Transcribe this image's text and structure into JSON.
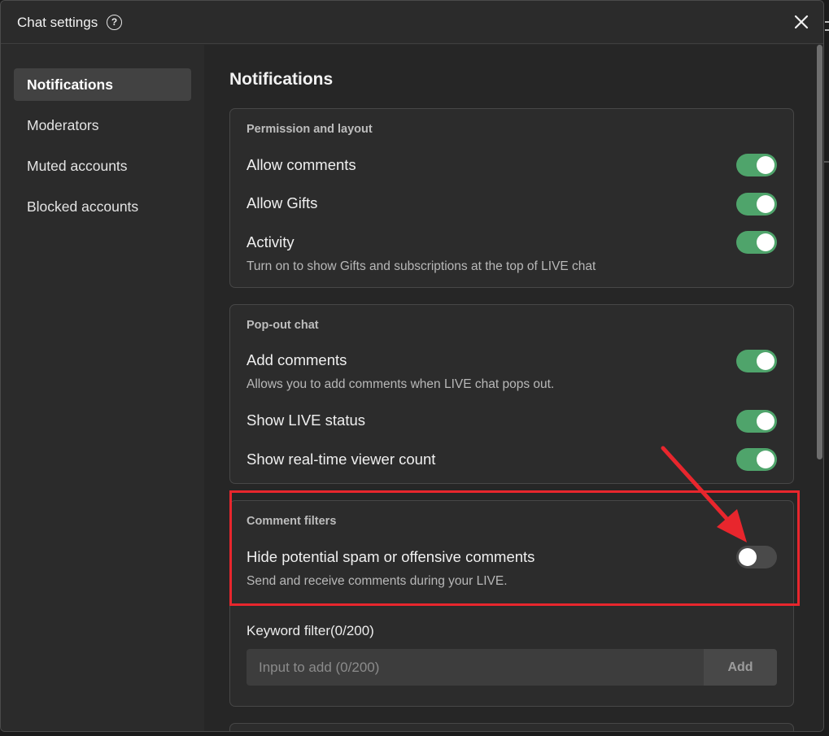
{
  "window": {
    "title": "Chat settings"
  },
  "sidebar": {
    "items": [
      {
        "label": "Notifications",
        "active": true
      },
      {
        "label": "Moderators",
        "active": false
      },
      {
        "label": "Muted accounts",
        "active": false
      },
      {
        "label": "Blocked accounts",
        "active": false
      }
    ]
  },
  "main": {
    "title": "Notifications",
    "sections": [
      {
        "title": "Permission and layout",
        "rows": [
          {
            "label": "Allow comments",
            "toggle": "on"
          },
          {
            "label": "Allow Gifts",
            "toggle": "on"
          },
          {
            "label": "Activity",
            "description": "Turn on to show Gifts and subscriptions at the top of LIVE chat",
            "toggle": "on"
          }
        ]
      },
      {
        "title": "Pop-out chat",
        "rows": [
          {
            "label": "Add comments",
            "description": "Allows you to add comments when LIVE chat pops out.",
            "toggle": "on"
          },
          {
            "label": "Show LIVE status",
            "toggle": "on"
          },
          {
            "label": "Show real-time viewer count",
            "toggle": "on"
          }
        ]
      },
      {
        "title": "Comment filters",
        "rows": [
          {
            "label": "Hide potential spam or offensive comments",
            "description": "Send and receive comments during your LIVE.",
            "toggle": "off"
          }
        ],
        "keyword_filter": {
          "label": "Keyword filter(0/200)",
          "placeholder": "Input to add (0/200)",
          "value": "",
          "button": "Add"
        }
      }
    ]
  },
  "colors": {
    "toggle_on": "#4fa46b",
    "toggle_off": "#4a4a4a",
    "annotation": "#e8262d"
  },
  "icons": [
    "help-icon",
    "close-icon"
  ]
}
